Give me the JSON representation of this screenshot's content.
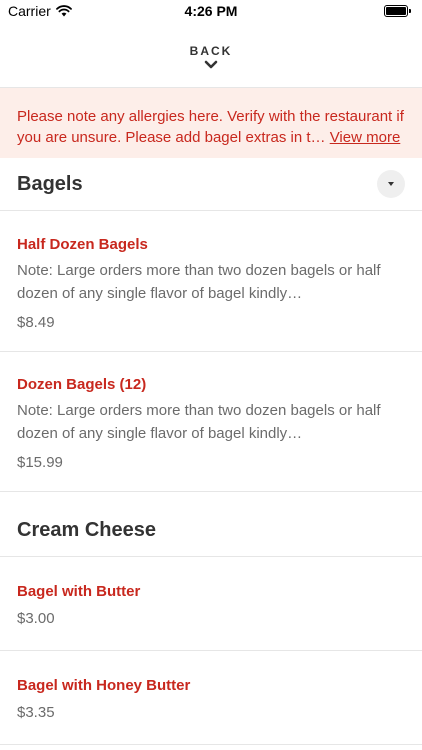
{
  "status_bar": {
    "carrier": "Carrier",
    "time": "4:26 PM"
  },
  "header": {
    "back_label": "BACK"
  },
  "notice": {
    "text": "Please note any allergies here. Verify with the restaurant if you are unsure. Please add bagel extras in t…",
    "link_label": "View more"
  },
  "sections": [
    {
      "title": "Bagels",
      "items": [
        {
          "name": "Half Dozen Bagels",
          "description": "Note: Large orders more than two dozen bagels or half dozen of any single flavor of bagel kindly…",
          "price": "$8.49"
        },
        {
          "name": "Dozen Bagels (12)",
          "description": "Note: Large orders more than two dozen bagels or half dozen of any single flavor of bagel kindly…",
          "price": "$15.99"
        }
      ]
    },
    {
      "title": "Cream Cheese",
      "items": [
        {
          "name": "Bagel with Butter",
          "price": "$3.00"
        },
        {
          "name": "Bagel with Honey Butter",
          "price": "$3.35"
        }
      ]
    }
  ],
  "colors": {
    "accent": "#c8281e",
    "notice_bg": "#fdeee9",
    "muted_text": "#6b6b6b"
  },
  "icons": {
    "wifi": "wifi-icon",
    "battery": "battery-icon",
    "back": "chevron-down-icon",
    "section_toggle": "caret-down-icon"
  }
}
